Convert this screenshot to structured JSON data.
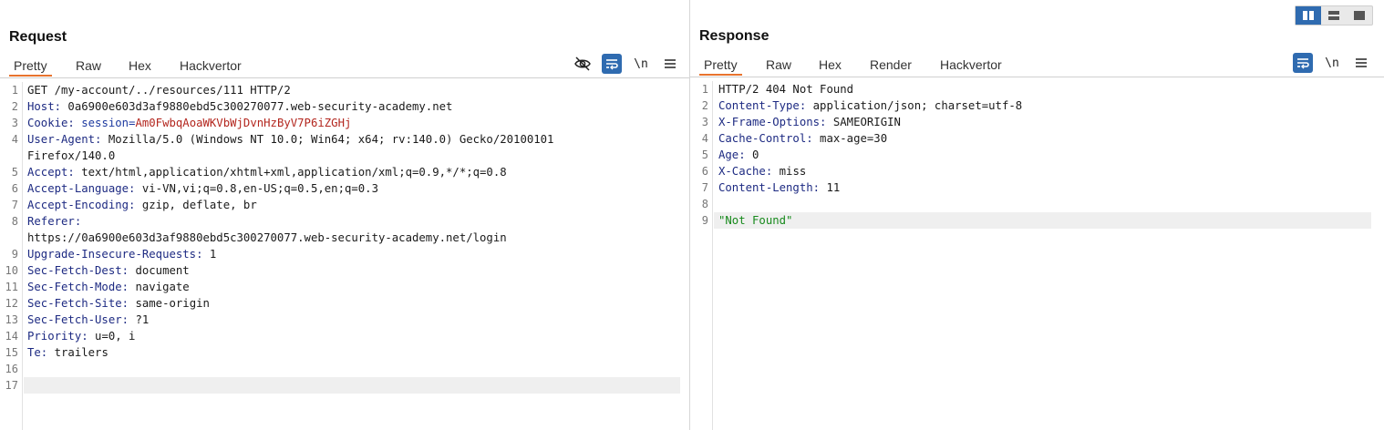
{
  "request": {
    "title": "Request",
    "tabs": [
      {
        "label": "Pretty",
        "active": true
      },
      {
        "label": "Raw",
        "active": false
      },
      {
        "label": "Hex",
        "active": false
      },
      {
        "label": "Hackvertor",
        "active": false
      }
    ],
    "toolbar": {
      "newline_label": "\\n",
      "icons": [
        "hide-nonprintable-icon",
        "word-wrap-icon",
        "menu-icon"
      ]
    },
    "lines": [
      {
        "num": "1",
        "key": "GET /my-account/../resources/111 HTTP/2",
        "value": ""
      },
      {
        "num": "2",
        "key": "Host:",
        "value": " 0a6900e603d3af9880ebd5c300270077.web-security-academy.net"
      },
      {
        "num": "3",
        "key": "Cookie:",
        "value": " session=",
        "cookie_value": "Am0FwbqAoaWKVbWjDvnHzByV7P6iZGHj"
      },
      {
        "num": "4",
        "key": "User-Agent:",
        "value": " Mozilla/5.0 (Windows NT 10.0; Win64; x64; rv:140.0) Gecko/20100101"
      },
      {
        "num": "",
        "key": "",
        "value": "Firefox/140.0"
      },
      {
        "num": "5",
        "key": "Accept:",
        "value": " text/html,application/xhtml+xml,application/xml;q=0.9,*/*;q=0.8"
      },
      {
        "num": "6",
        "key": "Accept-Language:",
        "value": " vi-VN,vi;q=0.8,en-US;q=0.5,en;q=0.3"
      },
      {
        "num": "7",
        "key": "Accept-Encoding:",
        "value": " gzip, deflate, br"
      },
      {
        "num": "8",
        "key": "Referer:",
        "value": ""
      },
      {
        "num": "",
        "key": "",
        "value": "https://0a6900e603d3af9880ebd5c300270077.web-security-academy.net/login"
      },
      {
        "num": "9",
        "key": "Upgrade-Insecure-Requests:",
        "value": " 1"
      },
      {
        "num": "10",
        "key": "Sec-Fetch-Dest:",
        "value": " document"
      },
      {
        "num": "11",
        "key": "Sec-Fetch-Mode:",
        "value": " navigate"
      },
      {
        "num": "12",
        "key": "Sec-Fetch-Site:",
        "value": " same-origin"
      },
      {
        "num": "13",
        "key": "Sec-Fetch-User:",
        "value": " ?1"
      },
      {
        "num": "14",
        "key": "Priority:",
        "value": " u=0, i"
      },
      {
        "num": "15",
        "key": "Te:",
        "value": " trailers"
      },
      {
        "num": "16",
        "key": "",
        "value": ""
      },
      {
        "num": "17",
        "key": "",
        "value": ""
      }
    ]
  },
  "response": {
    "title": "Response",
    "tabs": [
      {
        "label": "Pretty",
        "active": true
      },
      {
        "label": "Raw",
        "active": false
      },
      {
        "label": "Hex",
        "active": false
      },
      {
        "label": "Render",
        "active": false
      },
      {
        "label": "Hackvertor",
        "active": false
      }
    ],
    "toolbar": {
      "newline_label": "\\n",
      "icons": [
        "word-wrap-icon",
        "menu-icon"
      ]
    },
    "lines": [
      {
        "num": "1",
        "key": "HTTP/2 404 Not Found",
        "value": ""
      },
      {
        "num": "2",
        "key": "Content-Type:",
        "value": " application/json; charset=utf-8"
      },
      {
        "num": "3",
        "key": "X-Frame-Options:",
        "value": " SAMEORIGIN"
      },
      {
        "num": "4",
        "key": "Cache-Control:",
        "value": " max-age=30"
      },
      {
        "num": "5",
        "key": "Age:",
        "value": " 0"
      },
      {
        "num": "6",
        "key": "X-Cache:",
        "value": " miss"
      },
      {
        "num": "7",
        "key": "Content-Length:",
        "value": " 11"
      },
      {
        "num": "8",
        "key": "",
        "value": ""
      },
      {
        "num": "9",
        "key": "",
        "value": "",
        "string": "\"Not Found\""
      }
    ]
  },
  "layout_buttons": [
    "split-vertical-icon",
    "split-horizontal-icon",
    "single-pane-icon"
  ],
  "colors": {
    "accent_tab": "#e8732e",
    "tool_blue": "#2f6bb0",
    "header_key": "#1d2a82",
    "cookie_value": "#b3261e",
    "json_string": "#178a1c",
    "highlight_row": "#efefef"
  }
}
